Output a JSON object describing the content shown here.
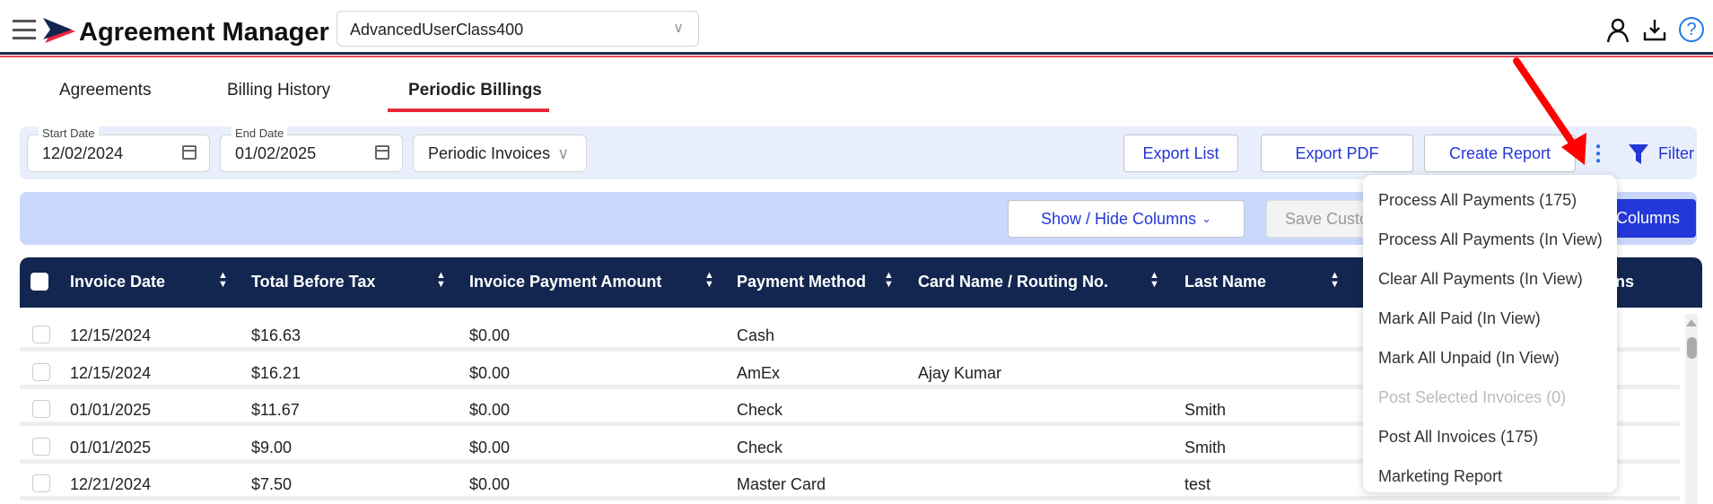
{
  "header": {
    "title": "Agreement Manager",
    "account_select": "AdvancedUserClass400",
    "icons": [
      "menu-icon",
      "logo-icon",
      "user-icon",
      "download-icon",
      "help-icon"
    ]
  },
  "tabs": [
    {
      "label": "Agreements"
    },
    {
      "label": "Billing History"
    },
    {
      "label": "Periodic Billings",
      "active": true
    }
  ],
  "filters": {
    "start_date_label": "Start Date",
    "start_date": "12/02/2024",
    "end_date_label": "End Date",
    "end_date": "01/02/2025",
    "invoice_type": "Periodic Invoices"
  },
  "toolbar": {
    "export_list": "Export List",
    "export_pdf": "Export PDF",
    "create_report": "Create Report",
    "filter": "Filter"
  },
  "column_bar": {
    "show_hide": "Show / Hide Columns",
    "save_custom": "Save Custo",
    "columns_button": "Columns"
  },
  "table": {
    "columns": [
      "Invoice Date",
      "Total Before Tax",
      "Invoice Payment Amount",
      "Payment Method",
      "Card Name / Routing No.",
      "Last Name",
      "ns"
    ],
    "rows": [
      [
        "12/15/2024",
        "$16.63",
        "$0.00",
        "Cash",
        "",
        ""
      ],
      [
        "12/15/2024",
        "$16.21",
        "$0.00",
        "AmEx",
        "Ajay Kumar",
        ""
      ],
      [
        "01/01/2025",
        "$11.67",
        "$0.00",
        "Check",
        "",
        "Smith"
      ],
      [
        "01/01/2025",
        "$9.00",
        "$0.00",
        "Check",
        "",
        "Smith"
      ],
      [
        "12/21/2024",
        "$7.50",
        "$0.00",
        "Master Card",
        "",
        "test"
      ]
    ]
  },
  "menu": {
    "items": [
      {
        "label": "Process All Payments (175)",
        "disabled": false
      },
      {
        "label": "Process All Payments (In View)",
        "disabled": false
      },
      {
        "label": "Clear All Payments (In View)",
        "disabled": false
      },
      {
        "label": "Mark All Paid (In View)",
        "disabled": false
      },
      {
        "label": "Mark All Unpaid (In View)",
        "disabled": false
      },
      {
        "label": "Post Selected Invoices (0)",
        "disabled": true
      },
      {
        "label": "Post All Invoices (175)",
        "disabled": false
      },
      {
        "label": "Marketing Report",
        "disabled": false
      }
    ]
  },
  "colors": {
    "navy": "#12264f",
    "accent_red": "#e8283a",
    "link_blue": "#2436d6",
    "primary_button": "#2437d8"
  }
}
